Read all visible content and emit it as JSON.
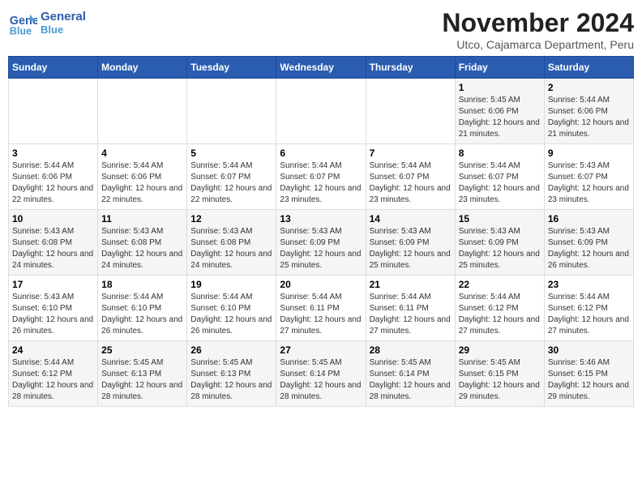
{
  "logo": {
    "text1": "General",
    "text2": "Blue"
  },
  "title": "November 2024",
  "subtitle": "Utco, Cajamarca Department, Peru",
  "days_header": [
    "Sunday",
    "Monday",
    "Tuesday",
    "Wednesday",
    "Thursday",
    "Friday",
    "Saturday"
  ],
  "weeks": [
    [
      {
        "day": "",
        "info": ""
      },
      {
        "day": "",
        "info": ""
      },
      {
        "day": "",
        "info": ""
      },
      {
        "day": "",
        "info": ""
      },
      {
        "day": "",
        "info": ""
      },
      {
        "day": "1",
        "info": "Sunrise: 5:45 AM\nSunset: 6:06 PM\nDaylight: 12 hours and 21 minutes."
      },
      {
        "day": "2",
        "info": "Sunrise: 5:44 AM\nSunset: 6:06 PM\nDaylight: 12 hours and 21 minutes."
      }
    ],
    [
      {
        "day": "3",
        "info": "Sunrise: 5:44 AM\nSunset: 6:06 PM\nDaylight: 12 hours and 22 minutes."
      },
      {
        "day": "4",
        "info": "Sunrise: 5:44 AM\nSunset: 6:06 PM\nDaylight: 12 hours and 22 minutes."
      },
      {
        "day": "5",
        "info": "Sunrise: 5:44 AM\nSunset: 6:07 PM\nDaylight: 12 hours and 22 minutes."
      },
      {
        "day": "6",
        "info": "Sunrise: 5:44 AM\nSunset: 6:07 PM\nDaylight: 12 hours and 23 minutes."
      },
      {
        "day": "7",
        "info": "Sunrise: 5:44 AM\nSunset: 6:07 PM\nDaylight: 12 hours and 23 minutes."
      },
      {
        "day": "8",
        "info": "Sunrise: 5:44 AM\nSunset: 6:07 PM\nDaylight: 12 hours and 23 minutes."
      },
      {
        "day": "9",
        "info": "Sunrise: 5:43 AM\nSunset: 6:07 PM\nDaylight: 12 hours and 23 minutes."
      }
    ],
    [
      {
        "day": "10",
        "info": "Sunrise: 5:43 AM\nSunset: 6:08 PM\nDaylight: 12 hours and 24 minutes."
      },
      {
        "day": "11",
        "info": "Sunrise: 5:43 AM\nSunset: 6:08 PM\nDaylight: 12 hours and 24 minutes."
      },
      {
        "day": "12",
        "info": "Sunrise: 5:43 AM\nSunset: 6:08 PM\nDaylight: 12 hours and 24 minutes."
      },
      {
        "day": "13",
        "info": "Sunrise: 5:43 AM\nSunset: 6:09 PM\nDaylight: 12 hours and 25 minutes."
      },
      {
        "day": "14",
        "info": "Sunrise: 5:43 AM\nSunset: 6:09 PM\nDaylight: 12 hours and 25 minutes."
      },
      {
        "day": "15",
        "info": "Sunrise: 5:43 AM\nSunset: 6:09 PM\nDaylight: 12 hours and 25 minutes."
      },
      {
        "day": "16",
        "info": "Sunrise: 5:43 AM\nSunset: 6:09 PM\nDaylight: 12 hours and 26 minutes."
      }
    ],
    [
      {
        "day": "17",
        "info": "Sunrise: 5:43 AM\nSunset: 6:10 PM\nDaylight: 12 hours and 26 minutes."
      },
      {
        "day": "18",
        "info": "Sunrise: 5:44 AM\nSunset: 6:10 PM\nDaylight: 12 hours and 26 minutes."
      },
      {
        "day": "19",
        "info": "Sunrise: 5:44 AM\nSunset: 6:10 PM\nDaylight: 12 hours and 26 minutes."
      },
      {
        "day": "20",
        "info": "Sunrise: 5:44 AM\nSunset: 6:11 PM\nDaylight: 12 hours and 27 minutes."
      },
      {
        "day": "21",
        "info": "Sunrise: 5:44 AM\nSunset: 6:11 PM\nDaylight: 12 hours and 27 minutes."
      },
      {
        "day": "22",
        "info": "Sunrise: 5:44 AM\nSunset: 6:12 PM\nDaylight: 12 hours and 27 minutes."
      },
      {
        "day": "23",
        "info": "Sunrise: 5:44 AM\nSunset: 6:12 PM\nDaylight: 12 hours and 27 minutes."
      }
    ],
    [
      {
        "day": "24",
        "info": "Sunrise: 5:44 AM\nSunset: 6:12 PM\nDaylight: 12 hours and 28 minutes."
      },
      {
        "day": "25",
        "info": "Sunrise: 5:45 AM\nSunset: 6:13 PM\nDaylight: 12 hours and 28 minutes."
      },
      {
        "day": "26",
        "info": "Sunrise: 5:45 AM\nSunset: 6:13 PM\nDaylight: 12 hours and 28 minutes."
      },
      {
        "day": "27",
        "info": "Sunrise: 5:45 AM\nSunset: 6:14 PM\nDaylight: 12 hours and 28 minutes."
      },
      {
        "day": "28",
        "info": "Sunrise: 5:45 AM\nSunset: 6:14 PM\nDaylight: 12 hours and 28 minutes."
      },
      {
        "day": "29",
        "info": "Sunrise: 5:45 AM\nSunset: 6:15 PM\nDaylight: 12 hours and 29 minutes."
      },
      {
        "day": "30",
        "info": "Sunrise: 5:46 AM\nSunset: 6:15 PM\nDaylight: 12 hours and 29 minutes."
      }
    ]
  ]
}
